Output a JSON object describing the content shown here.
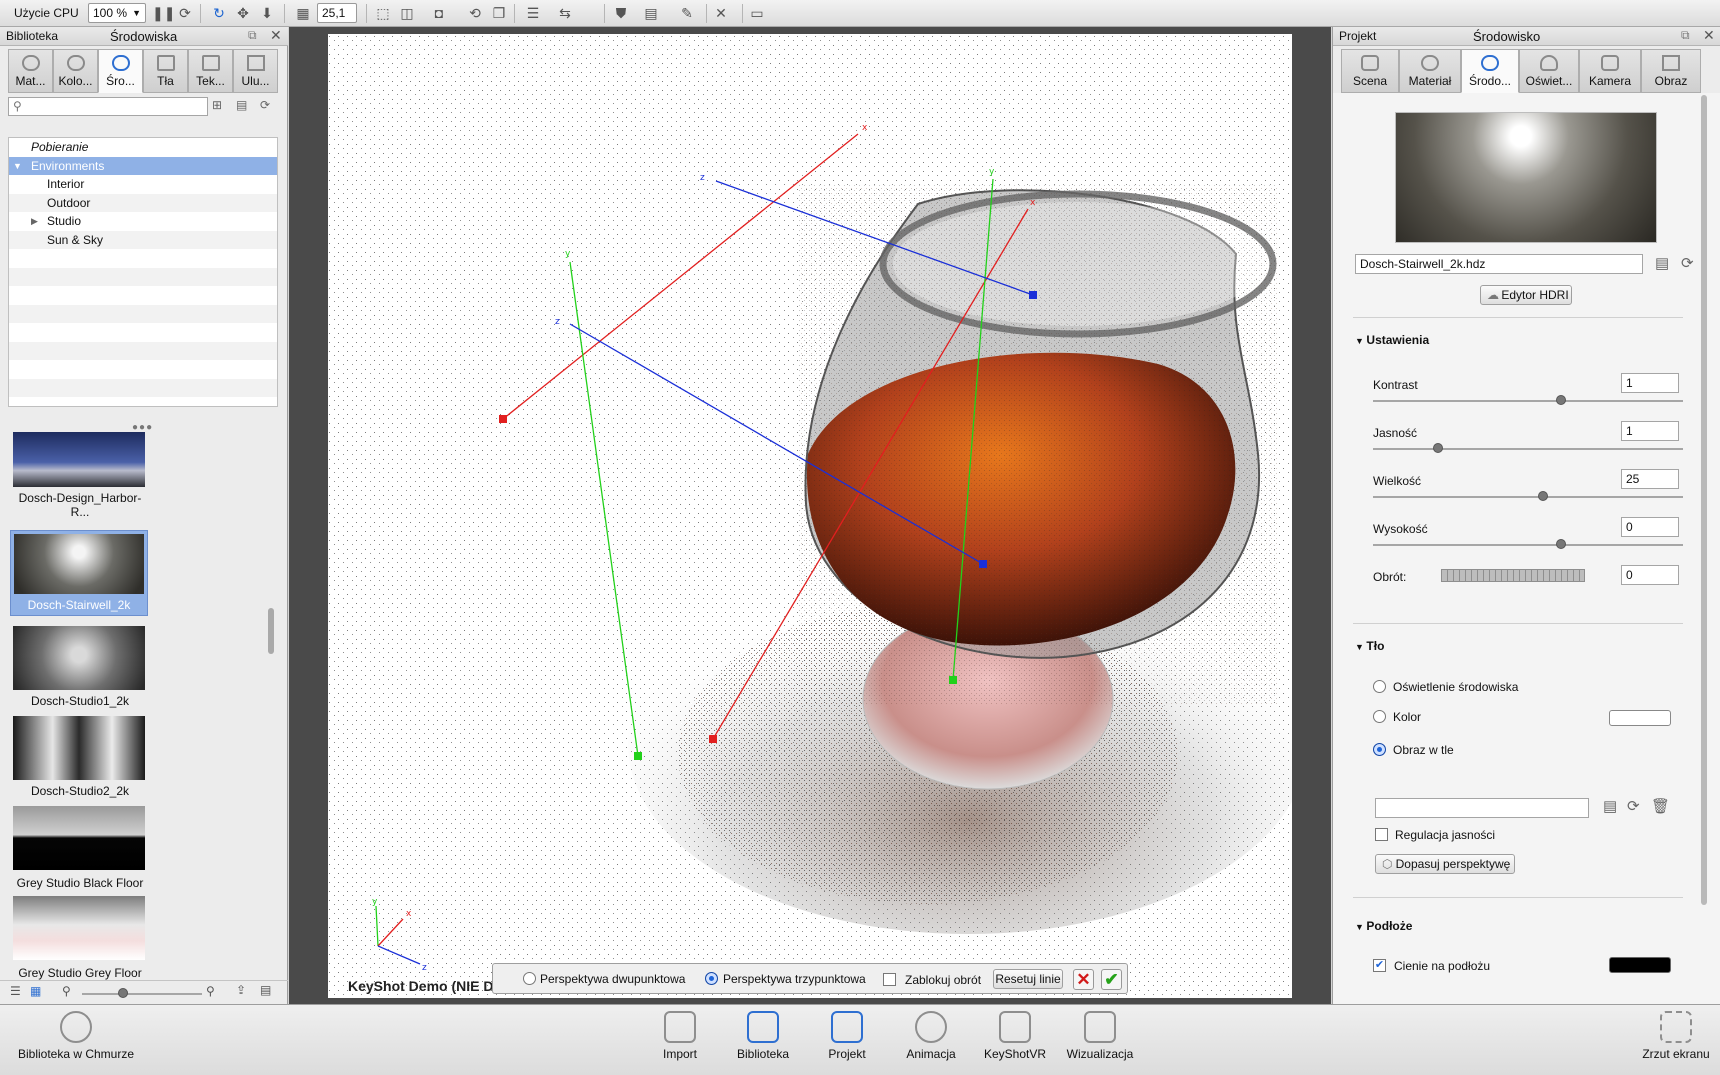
{
  "toolbar": {
    "cpu_label": "Użycie CPU",
    "zoom_value": "100 %",
    "resolution_value": "25,1"
  },
  "left_panel": {
    "title_library": "Biblioteka",
    "title_section": "Środowiska",
    "tabs": [
      "Mat...",
      "Kolo...",
      "Śro...",
      "Tła",
      "Tek...",
      "Ulu..."
    ],
    "search_placeholder": "",
    "tree": {
      "download": "Pobieranie",
      "root": "Environments",
      "items": [
        "Interior",
        "Outdoor",
        "Studio",
        "Sun & Sky"
      ]
    },
    "thumbnails": [
      {
        "label": "Dosch-Design_Harbor-R..."
      },
      {
        "label": "Dosch-Stairwell_2k",
        "selected": true
      },
      {
        "label": "Dosch-Studio1_2k"
      },
      {
        "label": "Dosch-Studio2_2k"
      },
      {
        "label": "Grey Studio Black Floor"
      },
      {
        "label": "Grey Studio Grey Floor"
      }
    ]
  },
  "viewport": {
    "watermark": "KeyShot Demo (NIE DO UŻYTKU KOMERCYJNEGO)",
    "persp_two": "Perspektywa dwupunktowa",
    "persp_three": "Perspektywa trzypunktowa",
    "lock_rotation": "Zablokuj obrót",
    "reset_lines": "Resetuj linie",
    "axis_labels": {
      "x": "x",
      "y": "y",
      "z": "z"
    }
  },
  "right_panel": {
    "title_project": "Projekt",
    "title_section": "Środowisko",
    "tabs": [
      "Scena",
      "Materiał",
      "Środo...",
      "Oświet...",
      "Kamera",
      "Obraz"
    ],
    "hdri_file": "Dosch-Stairwell_2k.hdz",
    "hdri_editor": "Edytor HDRI",
    "settings_title": "Ustawienia",
    "settings": [
      {
        "label": "Kontrast",
        "value": "1",
        "level": 0.61
      },
      {
        "label": "Jasność",
        "value": "1",
        "level": 0.2
      },
      {
        "label": "Wielkość",
        "value": "25",
        "level": 0.55
      },
      {
        "label": "Wysokość",
        "value": "0",
        "level": 0.61
      }
    ],
    "rotation_label": "Obrót:",
    "rotation_value": "0",
    "background_title": "Tło",
    "bg_options": [
      "Oświetlenie środowiska",
      "Kolor",
      "Obraz w tle"
    ],
    "bg_selected": "Obraz w tle",
    "brightness_adjust": "Regulacja jasności",
    "fit_perspective": "Dopasuj perspektywę",
    "ground_title": "Podłoże",
    "ground_shadows": "Cienie na podłożu",
    "colors": {
      "bg_color": "#ffffff",
      "shadow_color": "#000000"
    }
  },
  "bottom_bar": {
    "cloud_library": "Biblioteka w Chmurze",
    "items": [
      "Import",
      "Biblioteka",
      "Projekt",
      "Animacja",
      "KeyShotVR",
      "Wizualizacja"
    ],
    "screenshot": "Zrzut ekranu"
  }
}
